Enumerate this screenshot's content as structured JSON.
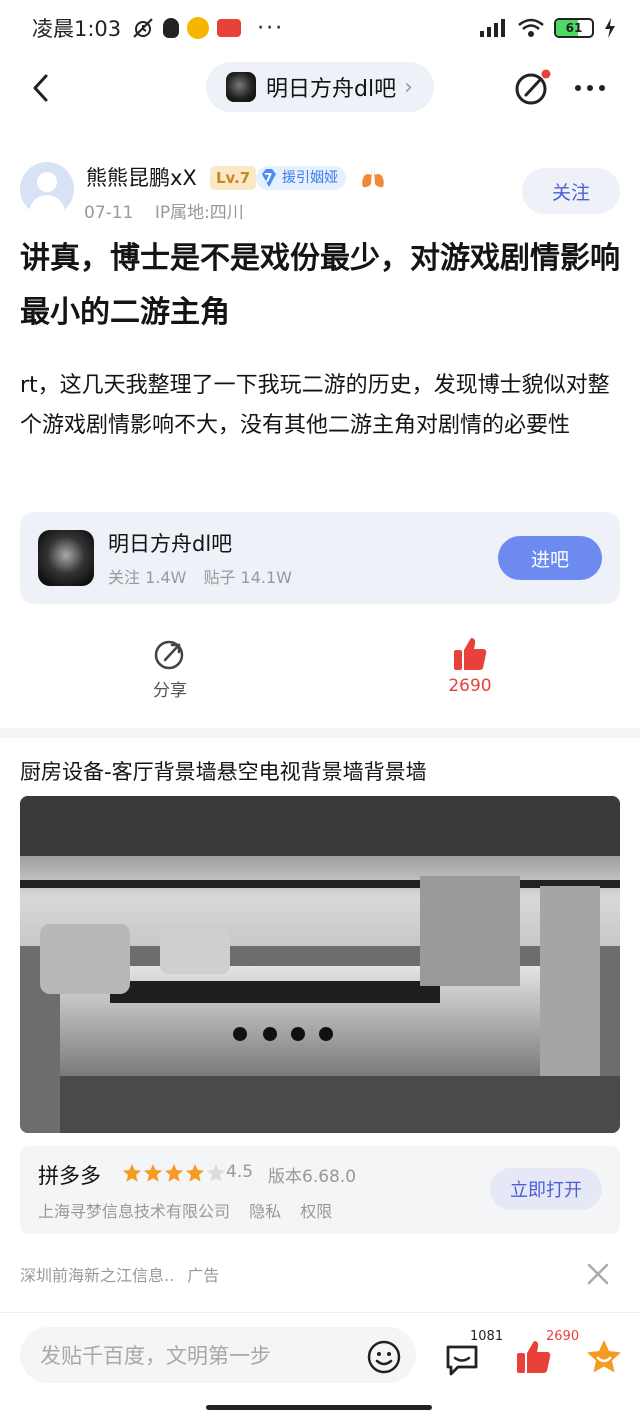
{
  "status_bar": {
    "time": "凌晨1:03",
    "battery": "61",
    "battery_level": 0.61
  },
  "nav": {
    "forum_name": "明日方舟dl吧",
    "chevron": "›"
  },
  "post": {
    "author": {
      "name": "熊熊昆鹏xX",
      "level": "Lv.7",
      "role_level": "7",
      "role_name": "援引姻娅",
      "date": "07-11",
      "location": "IP属地:四川"
    },
    "follow_label": "关注",
    "title": "讲真，博士是不是戏份最少，对游戏剧情影响最小的二游主角",
    "content": "rt，这几天我整理了一下我玩二游的历史，发现博士貌似对整个游戏剧情影响不大，没有其他二游主角对剧情的必要性"
  },
  "forum_card": {
    "name": "明日方舟dl吧",
    "followers": "关注 1.4W",
    "posts": "贴子 14.1W",
    "button": "进吧"
  },
  "actions": {
    "share_label": "分享",
    "like_count": "2690"
  },
  "ad": {
    "title": "厨房设备-客厅背景墙悬空电视背景墙背景墙",
    "app_name": "拼多多",
    "rating": "4.5",
    "rating_value": 4.5,
    "version": "版本6.68.0",
    "company": "上海寻梦信息技术有限公司",
    "privacy": "隐私",
    "permissions": "权限",
    "open_button": "立即打开",
    "advertiser": "深圳前海新之江信息..",
    "ad_label": "广告"
  },
  "bottom_bar": {
    "placeholder": "发贴千百度，文明第一步",
    "comment_count": "1081",
    "like_count": "2690"
  },
  "colors": {
    "accent": "#6c8af0",
    "like_red": "#e8413a",
    "card_bg": "#eef1f8",
    "star_orange": "#f59a23"
  }
}
